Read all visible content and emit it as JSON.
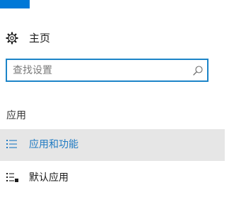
{
  "colors": {
    "accent": "#0078d7",
    "search_border": "#1c84c8",
    "selected_bg": "#e6e6e6",
    "selected_text": "#1f7ac2"
  },
  "home": {
    "icon": "gear-icon",
    "label": "主页"
  },
  "search": {
    "placeholder": "查找设置",
    "value": "",
    "icon": "search-icon"
  },
  "section": {
    "title": "应用"
  },
  "nav": {
    "items": [
      {
        "label": "应用和功能",
        "icon": "apps-list-icon",
        "selected": true
      },
      {
        "label": "默认应用",
        "icon": "default-apps-icon",
        "selected": false
      }
    ]
  }
}
